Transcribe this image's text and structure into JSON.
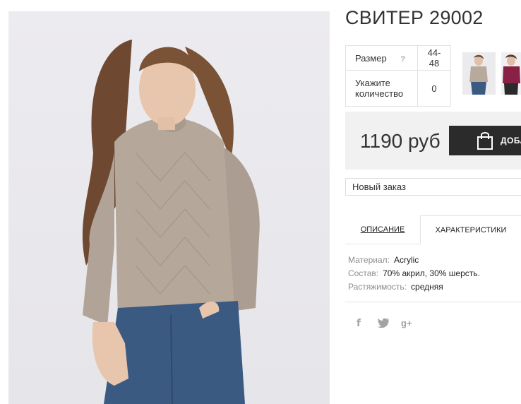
{
  "product": {
    "title": "СВИТЕР 29002",
    "image_alt": "Бежевый вязаный свитер"
  },
  "options": {
    "size_label": "Размер",
    "size_help": "?",
    "size_value": "44-48",
    "qty_label": "Укажите количество",
    "qty_value": "0"
  },
  "thumbnails": [
    {
      "name": "thumbnail-beige",
      "color": "#b7aa9d"
    },
    {
      "name": "thumbnail-burgundy",
      "color": "#8a2045"
    }
  ],
  "purchase": {
    "price": "1190 руб",
    "button_label": "ДОБАВИТЬ"
  },
  "order": {
    "selected": "Новый заказ"
  },
  "tabs": [
    {
      "label": "описание"
    },
    {
      "label": "Характеристики"
    }
  ],
  "properties": [
    {
      "key": "Материал:",
      "value": "Acrylic"
    },
    {
      "key": "Состав:",
      "value": "70% акрил, 30% шерсть."
    },
    {
      "key": "Растяжимость:",
      "value": "средняя"
    }
  ],
  "social": {
    "facebook": "f",
    "twitter": "twitter-icon",
    "googleplus": "g+"
  },
  "colors": {
    "sweater": "#b1a397",
    "jeans": "#3a5a82",
    "hair": "#7a5236",
    "button": "#2b2b2b"
  }
}
